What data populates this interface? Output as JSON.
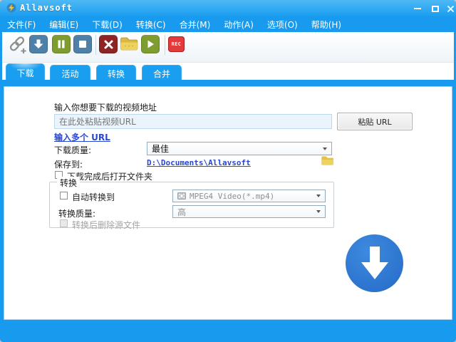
{
  "colors": {
    "accent_blue": "#189BEE",
    "tab_blue": "#1A9FF0",
    "toolbar_steel_blue": "#4E80A8",
    "toolbar_olive": "#7E9C30",
    "toolbar_dark_red": "#8E2424",
    "rec_red": "#E23B3B",
    "folder_yellow": "#E6C44C",
    "big_download_circle": "#2C74CE",
    "link_blue": "#2947D0"
  },
  "titlebar": {
    "title": "Allavsoft",
    "icon": "app-logo-icon"
  },
  "window_controls": {
    "minimize": "minimize-icon",
    "maximize": "maximize-icon",
    "close": "close-icon"
  },
  "menu": {
    "items": [
      "文件(F)",
      "编辑(E)",
      "下载(D)",
      "转换(C)",
      "合并(M)",
      "动作(A)",
      "选项(O)",
      "帮助(H)"
    ]
  },
  "toolbar": {
    "buttons": [
      {
        "name": "add-url",
        "icon": "chain-link-icon"
      },
      {
        "name": "download",
        "icon": "down-arrow-icon"
      },
      {
        "name": "pause",
        "icon": "pause-icon"
      },
      {
        "name": "stop",
        "icon": "stop-icon"
      },
      {
        "name": "delete",
        "icon": "x-icon"
      },
      {
        "name": "open-folder",
        "icon": "folder-icon"
      },
      {
        "name": "play",
        "icon": "play-icon"
      },
      {
        "name": "record",
        "icon": "rec-badge"
      }
    ],
    "rec_label": "REC"
  },
  "tabs": {
    "items": [
      {
        "label": "下载",
        "active": true
      },
      {
        "label": "活动",
        "active": false
      },
      {
        "label": "转换",
        "active": false
      },
      {
        "label": "合并",
        "active": false
      }
    ]
  },
  "main": {
    "url_label": "输入你想要下载的视频地址",
    "url_placeholder": "在此处粘贴视频URL",
    "paste_button_label": "粘贴 URL",
    "multi_url_link": "输入多个 URL",
    "quality_label": "下载质量:",
    "quality_value": "最佳",
    "save_label": "保存到:",
    "save_path": "D:\\Documents\\Allavsoft",
    "open_folder_label": "下载完成后打开文件夹",
    "convert": {
      "title": "转换",
      "auto_label": "自动转换到",
      "format_value": "MPEG4 Video(*.mp4)",
      "format_icon": "video-file-icon",
      "quality_label": "转换质量:",
      "quality_value": "高",
      "delete_label": "转换后删除源文件"
    }
  }
}
